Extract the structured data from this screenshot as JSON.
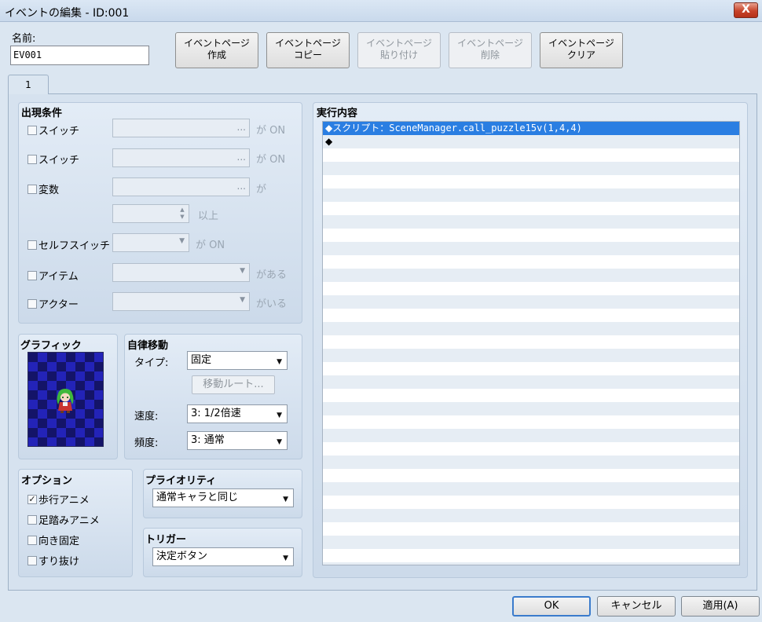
{
  "window": {
    "title": "イベントの編集 - ID:001",
    "close_label": "X"
  },
  "name": {
    "label": "名前:",
    "value": "EV001"
  },
  "page_buttons": [
    {
      "label": "イベントページ\n作成",
      "enabled": true
    },
    {
      "label": "イベントページ\nコピー",
      "enabled": true
    },
    {
      "label": "イベントページ\n貼り付け",
      "enabled": false
    },
    {
      "label": "イベントページ\n削除",
      "enabled": false
    },
    {
      "label": "イベントページ\nクリア",
      "enabled": true
    }
  ],
  "tabs": [
    {
      "label": "1"
    }
  ],
  "conditions": {
    "title": "出現条件",
    "switch1": {
      "label": "スイッチ",
      "suffix": "が ON"
    },
    "switch2": {
      "label": "スイッチ",
      "suffix": "が ON"
    },
    "variable": {
      "label": "変数",
      "suffix": "が",
      "suffix2": "以上"
    },
    "self_switch": {
      "label": "セルフスイッチ",
      "suffix": "が ON"
    },
    "item": {
      "label": "アイテム",
      "suffix": "がある"
    },
    "actor": {
      "label": "アクター",
      "suffix": "がいる"
    },
    "dots": "..."
  },
  "graphic": {
    "title": "グラフィック"
  },
  "autonomous": {
    "title": "自律移動",
    "type_label": "タイプ:",
    "type_value": "固定",
    "route_button": "移動ルート...",
    "speed_label": "速度:",
    "speed_value": "3: 1/2倍速",
    "freq_label": "頻度:",
    "freq_value": "3: 通常"
  },
  "options": {
    "title": "オプション",
    "items": [
      {
        "label": "歩行アニメ",
        "checked": true
      },
      {
        "label": "足踏みアニメ",
        "checked": false
      },
      {
        "label": "向き固定",
        "checked": false
      },
      {
        "label": "すり抜け",
        "checked": false
      }
    ]
  },
  "priority": {
    "title": "プライオリティ",
    "value": "通常キャラと同じ"
  },
  "trigger": {
    "title": "トリガー",
    "value": "決定ボタン"
  },
  "contents": {
    "title": "実行内容",
    "line1_prefix": "◆スクリプト：",
    "line1_code": "SceneManager.call_puzzle15v(1,4,4)",
    "line2": "◆"
  },
  "buttons": {
    "ok": "OK",
    "cancel": "キャンセル",
    "apply": "適用(A)"
  },
  "colors": {
    "selection": "#2a7ee2",
    "checker_light": "#2323b8",
    "checker_dark": "#141468"
  }
}
